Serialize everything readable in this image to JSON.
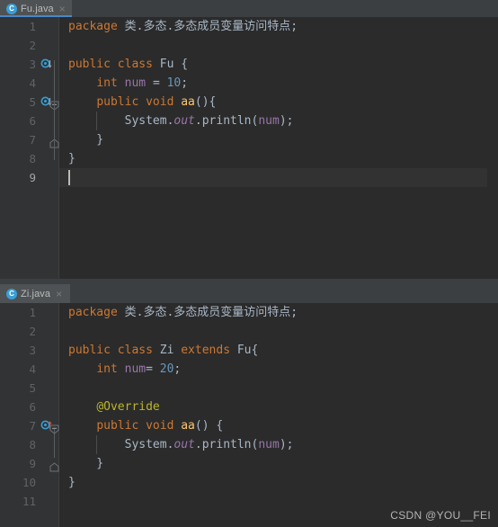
{
  "theme": {
    "editor_bg": "#2b2b2b",
    "gutter_bg": "#313335",
    "chrome_bg": "#3c3f41",
    "tab_active_bg": "#4e5254",
    "tab_underline": "#4a88c7",
    "current_line_bg": "#323232",
    "keyword": "#cc7832",
    "field": "#9876aa",
    "number": "#6897bb",
    "method": "#ffc66d",
    "annotation": "#bbb529",
    "text": "#a9b7c6",
    "line_number": "#606366"
  },
  "editors": [
    {
      "tab": {
        "icon": "java-class-icon",
        "icon_letter": "C",
        "label": "Fu.java",
        "close": "×",
        "active": true
      },
      "caret_line": 9,
      "lines": [
        {
          "n": "1",
          "gutter": "",
          "fold": "",
          "tokens": [
            {
              "t": "package ",
              "c": "kw"
            },
            {
              "t": "类.多态.多态成员变量访问特点",
              "c": "pln"
            },
            {
              "t": ";",
              "c": "pln"
            }
          ],
          "indent": 0
        },
        {
          "n": "2",
          "gutter": "",
          "fold": "",
          "tokens": [],
          "indent": 0
        },
        {
          "n": "3",
          "gutter": "overridden-method-icon",
          "fold": "",
          "tokens": [
            {
              "t": "public class ",
              "c": "kw"
            },
            {
              "t": "Fu ",
              "c": "cls"
            },
            {
              "t": "{",
              "c": "pln"
            }
          ],
          "indent": 0
        },
        {
          "n": "4",
          "gutter": "",
          "fold": "",
          "tokens": [
            {
              "t": "    ",
              "c": "pln"
            },
            {
              "t": "int ",
              "c": "kw"
            },
            {
              "t": "num ",
              "c": "fld"
            },
            {
              "t": "= ",
              "c": "pln"
            },
            {
              "t": "10",
              "c": "num-lit"
            },
            {
              "t": ";",
              "c": "pln"
            }
          ],
          "indent": 0
        },
        {
          "n": "5",
          "gutter": "overridden-method-icon",
          "fold": "fold-open",
          "tokens": [
            {
              "t": "    ",
              "c": "pln"
            },
            {
              "t": "public void ",
              "c": "kw"
            },
            {
              "t": "aa",
              "c": "mth"
            },
            {
              "t": "(){",
              "c": "pln"
            }
          ],
          "indent": 0
        },
        {
          "n": "6",
          "gutter": "",
          "fold": "",
          "tokens": [
            {
              "t": "        System.",
              "c": "pln"
            },
            {
              "t": "out",
              "c": "stat"
            },
            {
              "t": ".println(",
              "c": "pln"
            },
            {
              "t": "num",
              "c": "fld"
            },
            {
              "t": ");",
              "c": "pln"
            }
          ],
          "indent": 1
        },
        {
          "n": "7",
          "gutter": "",
          "fold": "fold-end",
          "tokens": [
            {
              "t": "    }",
              "c": "pln"
            }
          ],
          "indent": 0
        },
        {
          "n": "8",
          "gutter": "",
          "fold": "",
          "tokens": [
            {
              "t": "}",
              "c": "pln"
            }
          ],
          "indent": 0
        },
        {
          "n": "9",
          "gutter": "",
          "fold": "",
          "tokens": [],
          "indent": 0
        }
      ]
    },
    {
      "tab": {
        "icon": "java-class-icon",
        "icon_letter": "C",
        "label": "Zi.java",
        "close": "×",
        "active": false
      },
      "caret_line": 0,
      "lines": [
        {
          "n": "1",
          "gutter": "",
          "fold": "",
          "tokens": [
            {
              "t": "package ",
              "c": "kw"
            },
            {
              "t": "类.多态.多态成员变量访问特点",
              "c": "pln"
            },
            {
              "t": ";",
              "c": "pln"
            }
          ],
          "indent": 0
        },
        {
          "n": "2",
          "gutter": "",
          "fold": "",
          "tokens": [],
          "indent": 0
        },
        {
          "n": "3",
          "gutter": "",
          "fold": "",
          "tokens": [
            {
              "t": "public class ",
              "c": "kw"
            },
            {
              "t": "Zi ",
              "c": "cls"
            },
            {
              "t": "extends ",
              "c": "kw"
            },
            {
              "t": "Fu",
              "c": "cls"
            },
            {
              "t": "{",
              "c": "pln"
            }
          ],
          "indent": 0
        },
        {
          "n": "4",
          "gutter": "",
          "fold": "",
          "tokens": [
            {
              "t": "    ",
              "c": "pln"
            },
            {
              "t": "int ",
              "c": "kw"
            },
            {
              "t": "num",
              "c": "fld"
            },
            {
              "t": "= ",
              "c": "pln"
            },
            {
              "t": "20",
              "c": "num-lit"
            },
            {
              "t": ";",
              "c": "pln"
            }
          ],
          "indent": 0
        },
        {
          "n": "5",
          "gutter": "",
          "fold": "",
          "tokens": [],
          "indent": 0
        },
        {
          "n": "6",
          "gutter": "",
          "fold": "",
          "tokens": [
            {
              "t": "    ",
              "c": "pln"
            },
            {
              "t": "@Override",
              "c": "ann"
            }
          ],
          "indent": 0
        },
        {
          "n": "7",
          "gutter": "overriding-method-icon",
          "fold": "fold-open",
          "tokens": [
            {
              "t": "    ",
              "c": "pln"
            },
            {
              "t": "public void ",
              "c": "kw"
            },
            {
              "t": "aa",
              "c": "mth"
            },
            {
              "t": "() {",
              "c": "pln"
            }
          ],
          "indent": 0
        },
        {
          "n": "8",
          "gutter": "",
          "fold": "",
          "tokens": [
            {
              "t": "        System.",
              "c": "pln"
            },
            {
              "t": "out",
              "c": "stat"
            },
            {
              "t": ".println(",
              "c": "pln"
            },
            {
              "t": "num",
              "c": "fld"
            },
            {
              "t": ");",
              "c": "pln"
            }
          ],
          "indent": 1
        },
        {
          "n": "9",
          "gutter": "",
          "fold": "fold-end",
          "tokens": [
            {
              "t": "    }",
              "c": "pln"
            }
          ],
          "indent": 0
        },
        {
          "n": "10",
          "gutter": "",
          "fold": "",
          "tokens": [
            {
              "t": "}",
              "c": "pln"
            }
          ],
          "indent": 0
        },
        {
          "n": "11",
          "gutter": "",
          "fold": "",
          "tokens": [],
          "indent": 0
        }
      ]
    }
  ],
  "watermark": "CSDN @YOU__FEI"
}
